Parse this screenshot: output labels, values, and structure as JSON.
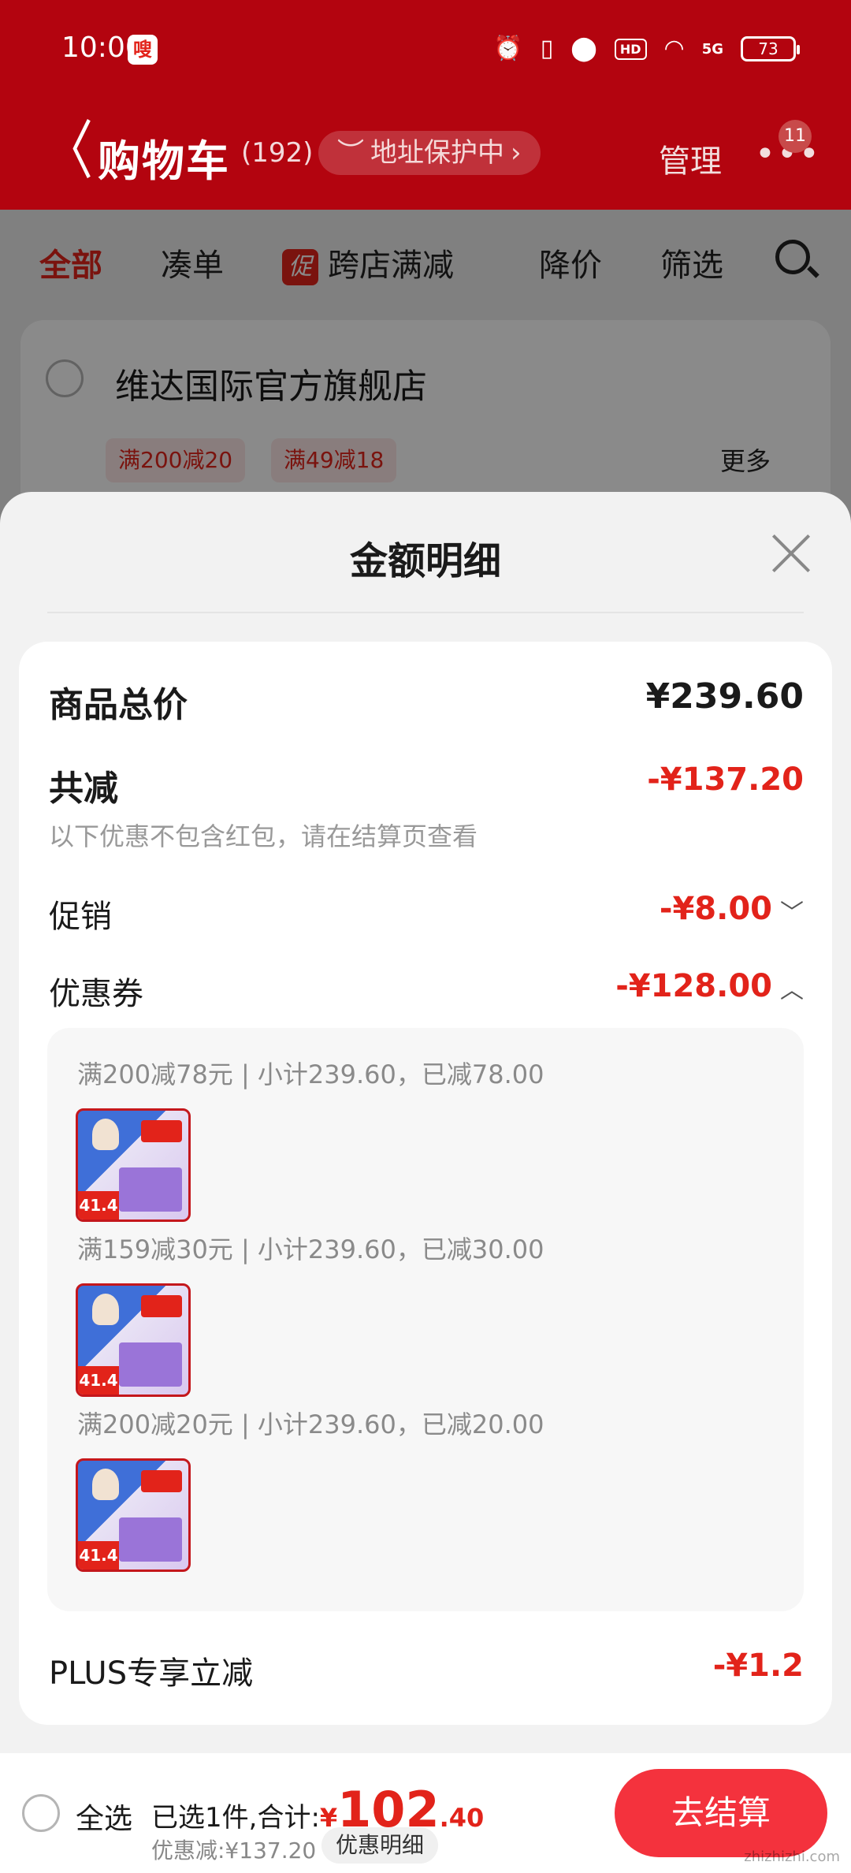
{
  "status_bar": {
    "time": "10:00",
    "app_icon_text": "嗖",
    "hd": "HD",
    "network": "5G",
    "battery": "73"
  },
  "header": {
    "back": "〈",
    "title": "购物车",
    "count": "(192)",
    "address_protection": "地址保护中",
    "manage": "管理",
    "more": "•••",
    "message_badge": "11"
  },
  "filter_tabs": {
    "all": "全部",
    "bundle": "凑单",
    "promo_tag": "促",
    "cross_store": "跨店满减",
    "price_drop": "降价",
    "filter": "筛选"
  },
  "store": {
    "name": "维达国际官方旗舰店",
    "coupons": [
      "满200减20",
      "满49减18"
    ],
    "more": "更多"
  },
  "sheet": {
    "title": "金额明细",
    "total_label": "商品总价",
    "total_value": "¥239.60",
    "reduce_label": "共减",
    "reduce_value": "-¥137.20",
    "reduce_note": "以下优惠不包含红包，请在结算页查看",
    "promo_label": "促销",
    "promo_value": "-¥8.00",
    "coupon_label": "优惠券",
    "coupon_value": "-¥128.00",
    "coupon_details": [
      {
        "text": "满200减78元 | 小计239.60，已减78.00",
        "thumb_price": "41.4"
      },
      {
        "text": "满159减30元 | 小计239.60，已减30.00",
        "thumb_price": "41.4"
      },
      {
        "text": "满200减20元 | 小计239.60，已减20.00",
        "thumb_price": "41.4"
      }
    ],
    "plus_label": "PLUS专享立减",
    "plus_value": "-¥1.2"
  },
  "bottom_bar": {
    "select_all": "全选",
    "selected_prefix": "已选1件,合计:",
    "currency": "¥",
    "total_int": "102",
    "total_dec": ".40",
    "discount": "优惠减:¥137.20",
    "detail_link": "优惠明细",
    "checkout": "去结算",
    "watermark": "zhizhizhi.com"
  }
}
